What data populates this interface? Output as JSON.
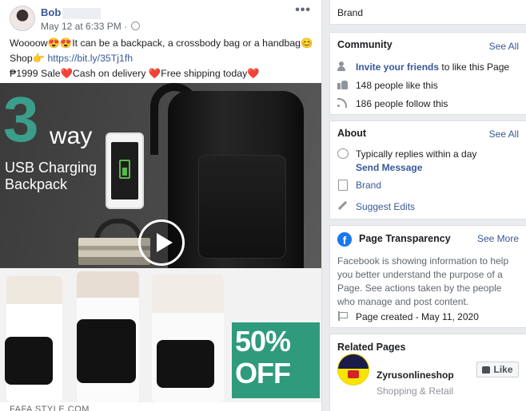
{
  "post": {
    "author": "Bob",
    "timestamp": "May 12 at 6:33 PM",
    "separator": " · ",
    "more_label": "•••",
    "text_line1": "Woooow😍😍It can be a backpack, a crossbody bag or a handbag😊",
    "text_line2_prefix": "Shop👉 ",
    "text_link": "https://bit.ly/35Tj1fh",
    "text_line3": "₱1999 Sale❤️Cash on delivery ❤️Free shipping today❤️",
    "image": {
      "big_number": "3",
      "big_word": "way",
      "subtitle_line1": "USB Charging",
      "subtitle_line2": "Backpack",
      "sale_line1": "50%",
      "sale_line2": "OFF"
    },
    "caption": "FAFA STYLE.COM"
  },
  "sidebar": {
    "top_label": "Brand",
    "community": {
      "title": "Community",
      "see_all": "See All",
      "invite_link": "Invite your friends",
      "invite_rest": " to like this Page",
      "likes": "148 people like this",
      "follows": "186 people follow this"
    },
    "about": {
      "title": "About",
      "see_all": "See All",
      "reply": "Typically replies within a day",
      "send_message": "Send Message",
      "category": "Brand",
      "suggest": "Suggest Edits"
    },
    "transparency": {
      "logo": "f",
      "title": "Page Transparency",
      "see_more": "See More",
      "description": "Facebook is showing information to help you better understand the purpose of a Page. See actions taken by the people who manage and post content.",
      "created": "Page created - May 11, 2020"
    },
    "related": {
      "title": "Related Pages",
      "page_name": "Zyrusonlineshop",
      "page_category": "Shopping & Retail",
      "like_label": "Like"
    }
  }
}
